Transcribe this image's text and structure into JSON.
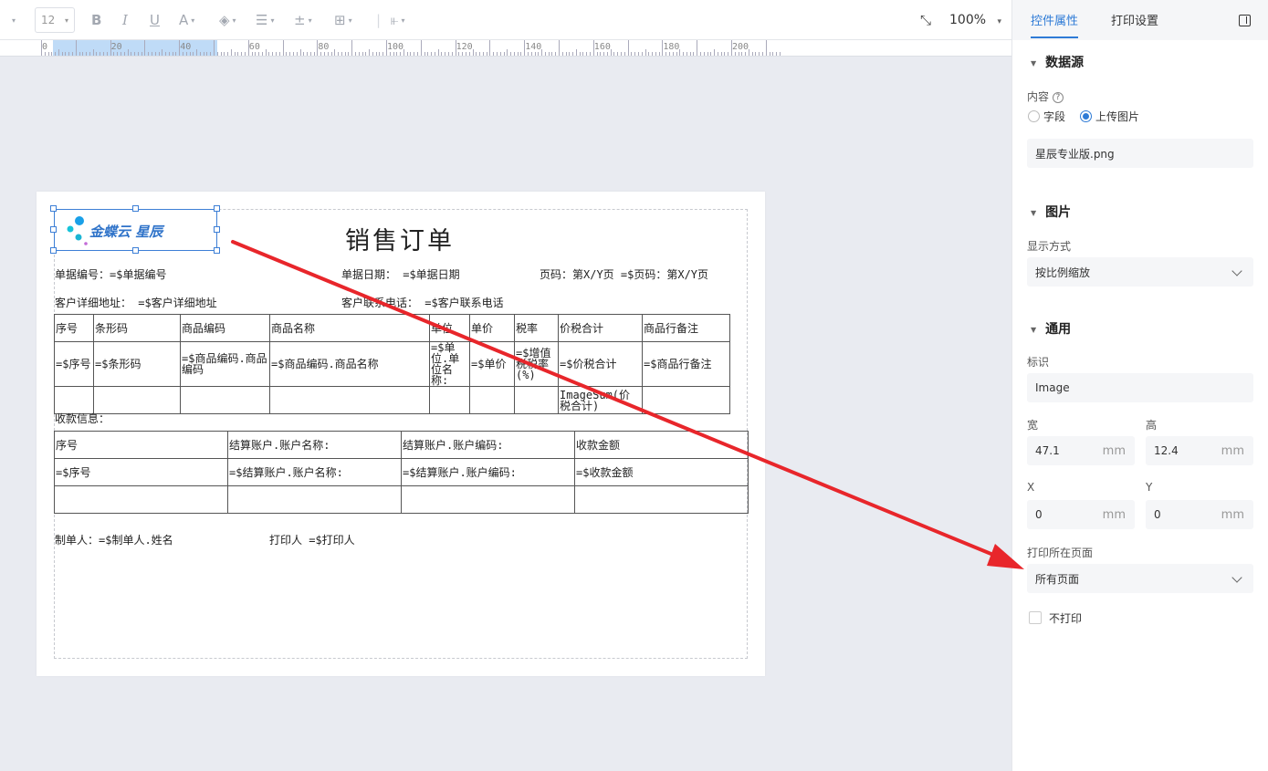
{
  "toolbar": {
    "font_size": "12",
    "zoom": "100%",
    "icons": [
      "bold-icon",
      "italic-icon",
      "underline-icon",
      "font-color-icon",
      "fill-color-icon",
      "align-icon",
      "vertical-align-icon",
      "border-icon",
      "layout-icon",
      "fit-page-icon"
    ]
  },
  "ruler": {
    "labels": [
      "0",
      "20",
      "40",
      "60",
      "80",
      "100",
      "120",
      "140",
      "160",
      "180",
      "200"
    ]
  },
  "document": {
    "title": "销售订单",
    "logo_text": "金蝶云 星辰",
    "fields": {
      "doc_no": "单据编号：=$单据编号",
      "doc_date": "单据日期： =$单据日期",
      "page": "页码：第X/Y页 =$页码：第X/Y页",
      "address": "客户详细地址： =$客户详细地址",
      "phone": "客户联系电话： =$客户联系电话",
      "payment_label": "收款信息：",
      "creator": "制单人：=$制单人.姓名",
      "printer": "打印人  =$打印人"
    },
    "items_table": {
      "headers": [
        "序号",
        "条形码",
        "商品编码",
        "商品名称",
        "单位",
        "单价",
        "税率",
        "价税合计",
        "商品行备注"
      ],
      "row": [
        "=$序号",
        "=$条形码",
        "=$商品编码.商品编码",
        "=$商品编码.商品名称",
        "=$单位.单位名称:",
        "=$单价",
        "=$增值税税率(%)",
        "=$价税合计",
        "=$商品行备注"
      ],
      "sum_row": [
        "",
        "",
        "",
        "",
        "",
        "",
        "",
        "ImageSum(价税合计)",
        ""
      ]
    },
    "payment_table": {
      "headers": [
        "序号",
        "结算账户.账户名称:",
        "结算账户.账户编码:",
        "收款金额"
      ],
      "row": [
        "=$序号",
        "=$结算账户.账户名称:",
        "=$结算账户.账户编码:",
        "=$收款金额"
      ],
      "empty": [
        "",
        "",
        "",
        ""
      ]
    }
  },
  "panel": {
    "tabs": [
      "控件属性",
      "打印设置"
    ],
    "datasource": {
      "section": "数据源",
      "content_label": "内容",
      "radio_field": "字段",
      "radio_upload": "上传图片",
      "file_name": "星辰专业版.png"
    },
    "image": {
      "section": "图片",
      "display_label": "显示方式",
      "display_value": "按比例缩放"
    },
    "general": {
      "section": "通用",
      "id_label": "标识",
      "id_value": "Image",
      "width_label": "宽",
      "width_value": "47.1",
      "height_label": "高",
      "height_value": "12.4",
      "x_label": "X",
      "x_value": "0",
      "y_label": "Y",
      "y_value": "0",
      "unit": "mm",
      "print_page_label": "打印所在页面",
      "print_page_value": "所有页面",
      "no_print_label": "不打印"
    }
  },
  "colors": {
    "accent": "#2e7bd6",
    "annotation_arrow": "#e8262b"
  }
}
